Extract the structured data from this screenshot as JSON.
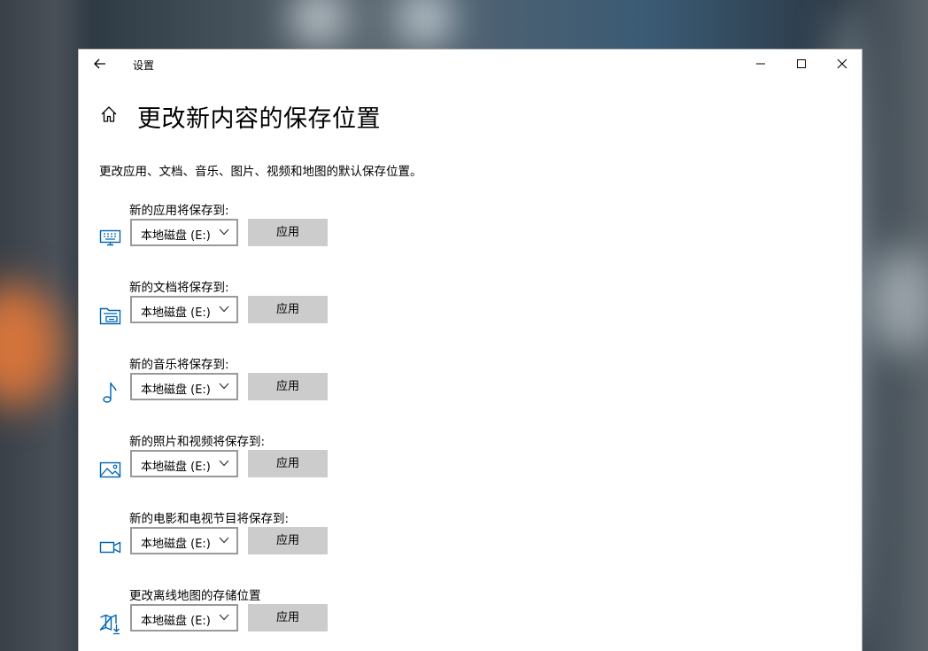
{
  "window": {
    "title": "设置",
    "controls": [
      "minimize-icon",
      "maximize-icon",
      "close-icon"
    ]
  },
  "page": {
    "title": "更改新内容的保存位置",
    "description": "更改应用、文档、音乐、图片、视频和地图的默认保存位置。"
  },
  "colors": {
    "accent": "#0063b1",
    "button_bg": "#cccccc",
    "dropdown_border": "#9a9a9a"
  },
  "sections": [
    {
      "label": "新的应用将保存到:",
      "icon": "monitor-keyboard-icon",
      "value": "本地磁盘 (E:)",
      "button": "应用"
    },
    {
      "label": "新的文档将保存到:",
      "icon": "document-folder-icon",
      "value": "本地磁盘 (E:)",
      "button": "应用"
    },
    {
      "label": "新的音乐将保存到:",
      "icon": "music-note-icon",
      "value": "本地磁盘 (E:)",
      "button": "应用"
    },
    {
      "label": "新的照片和视频将保存到:",
      "icon": "picture-icon",
      "value": "本地磁盘 (E:)",
      "button": "应用"
    },
    {
      "label": "新的电影和电视节目将保存到:",
      "icon": "video-camera-icon",
      "value": "本地磁盘 (E:)",
      "button": "应用"
    },
    {
      "label": "更改离线地图的存储位置",
      "icon": "map-download-icon",
      "value": "本地磁盘 (E:)",
      "button": "应用"
    }
  ]
}
